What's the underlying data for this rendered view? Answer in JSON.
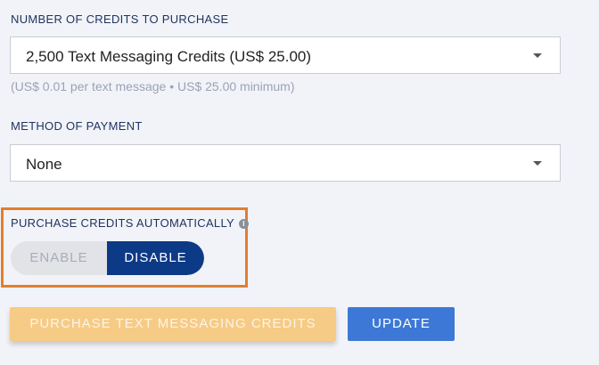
{
  "credits": {
    "label": "NUMBER OF CREDITS TO PURCHASE",
    "selected": "2,500 Text Messaging Credits (US$ 25.00)",
    "hint": "(US$ 0.01 per text message • US$ 25.00 minimum)"
  },
  "payment": {
    "label": "METHOD OF PAYMENT",
    "selected": "None"
  },
  "auto_purchase": {
    "label": "PURCHASE CREDITS AUTOMATICALLY",
    "info_icon": "i",
    "enable_label": "ENABLE",
    "disable_label": "DISABLE",
    "state": "disabled"
  },
  "actions": {
    "purchase_label": "PURCHASE TEXT MESSAGING CREDITS",
    "update_label": "UPDATE"
  },
  "colors": {
    "highlight_border": "#e07f2f",
    "toggle_active": "#0d3a86",
    "purchase_button": "#f6cb85",
    "update_button": "#3d78d6"
  }
}
